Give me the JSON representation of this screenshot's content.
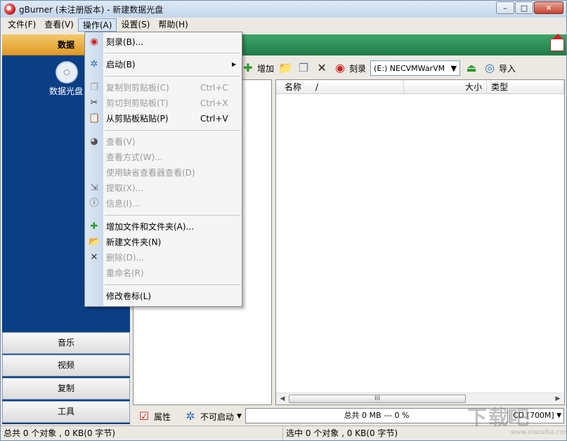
{
  "window": {
    "title": "gBurner (未注册版本) - 新建数据光盘"
  },
  "menubar": [
    "文件(F)",
    "查看(V)",
    "操作(A)",
    "设置(S)",
    "帮助(H)"
  ],
  "sidebar": {
    "active_tab": "数据",
    "disc_label": "数据光盘",
    "tabs": [
      "音乐",
      "视频",
      "复制",
      "工具"
    ]
  },
  "toolbar": {
    "add_label": "增加",
    "burn_label": "刻录",
    "drive_value": "(E:) NECVMWarVM",
    "import_label": "导入"
  },
  "file_list": {
    "columns": [
      "名称",
      "大小",
      "类型"
    ],
    "sort_indicator": "/",
    "scroll_grip": "III"
  },
  "bottom": {
    "properties_label": "属性",
    "boot_label": "不可启动",
    "progress_text": "总共 0 MB  --- 0 %",
    "disc_type": "CD [700M]"
  },
  "statusbar": {
    "total": "总共 0 个对象 , 0 KB(0 字节)",
    "selected": "选中 0 个对象 , 0 KB(0 字节)"
  },
  "dropdown_menu": {
    "items": [
      {
        "label": "刻录(B)...",
        "shortcut": "",
        "disabled": false,
        "icon": "burn-icon"
      },
      {
        "label": "启动(B)",
        "shortcut": "",
        "disabled": false,
        "icon": "boot-icon",
        "submenu": true
      },
      {
        "label": "复制到剪贴板(C)",
        "shortcut": "Ctrl+C",
        "disabled": true,
        "icon": "copy-icon"
      },
      {
        "label": "剪切到剪贴板(T)",
        "shortcut": "Ctrl+X",
        "disabled": true,
        "icon": "cut-icon"
      },
      {
        "label": "从剪贴板粘贴(P)",
        "shortcut": "Ctrl+V",
        "disabled": false,
        "icon": "paste-icon"
      },
      {
        "label": "查看(V)",
        "shortcut": "",
        "disabled": true,
        "icon": "view-icon"
      },
      {
        "label": "查看方式(W)...",
        "shortcut": "",
        "disabled": true,
        "icon": ""
      },
      {
        "label": "使用缺省查看器查看(D)",
        "shortcut": "",
        "disabled": true,
        "icon": ""
      },
      {
        "label": "提取(X)...",
        "shortcut": "",
        "disabled": true,
        "icon": "extract-icon"
      },
      {
        "label": "信息(I)...",
        "shortcut": "",
        "disabled": true,
        "icon": "info-icon"
      },
      {
        "label": "增加文件和文件夹(A)...",
        "shortcut": "",
        "disabled": false,
        "icon": "add-files-icon"
      },
      {
        "label": "新建文件夹(N)",
        "shortcut": "",
        "disabled": false,
        "icon": "new-folder-icon"
      },
      {
        "label": "删除(D)...",
        "shortcut": "",
        "disabled": true,
        "icon": "delete-icon"
      },
      {
        "label": "重命名(R)",
        "shortcut": "",
        "disabled": true,
        "icon": ""
      },
      {
        "label": "修改卷标(L)",
        "shortcut": "",
        "disabled": false,
        "icon": ""
      }
    ]
  }
}
